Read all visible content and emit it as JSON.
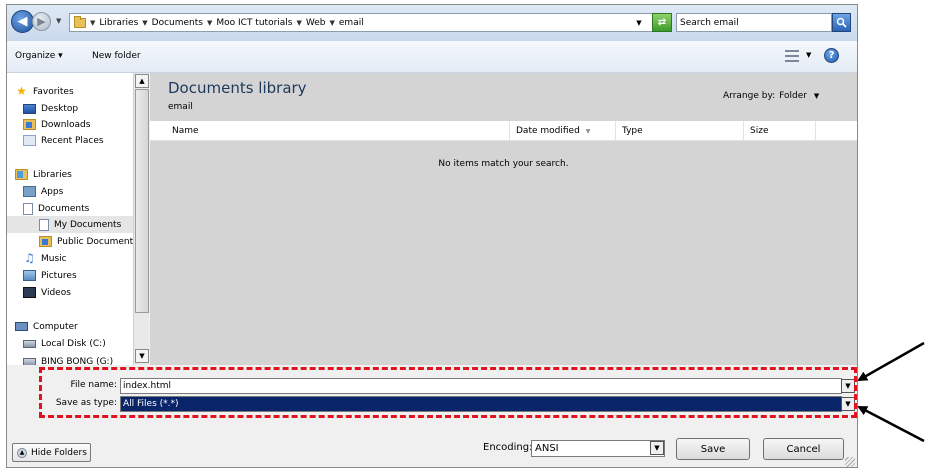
{
  "address_bar": {
    "crumbs": [
      "Libraries",
      "Documents",
      "Moo ICT tutorials",
      "Web",
      "email"
    ],
    "search_value": "Search email"
  },
  "toolbar": {
    "organize_label": "Organize ▾",
    "new_folder_label": "New folder",
    "help_label": "?"
  },
  "nav": {
    "favorites": {
      "label": "Favorites",
      "items": [
        "Desktop",
        "Downloads",
        "Recent Places"
      ]
    },
    "libraries": {
      "label": "Libraries",
      "items": [
        "Apps",
        "Documents",
        "My Documents",
        "Public Documents",
        "Music",
        "Pictures",
        "Videos"
      ]
    },
    "computer": {
      "label": "Computer",
      "items": [
        "Local Disk (C:)",
        "BING BONG (G:)"
      ]
    }
  },
  "content": {
    "title": "Documents library",
    "subtitle": "email",
    "arrange_label": "Arrange by:",
    "arrange_value": "Folder",
    "columns": [
      "Name",
      "Date modified",
      "Type",
      "Size"
    ],
    "empty_message": "No items match your search."
  },
  "fields": {
    "file_name_label": "File name:",
    "file_name_value": "index.html",
    "save_type_label": "Save as type:",
    "save_type_value": "All Files  (*.*)"
  },
  "footer": {
    "hide_folders_label": "Hide Folders",
    "encoding_label": "Encoding:",
    "encoding_value": "ANSI",
    "save_label": "Save",
    "cancel_label": "Cancel"
  },
  "colors": {
    "highlight": "#e0141e",
    "selection": "#0a246a"
  }
}
